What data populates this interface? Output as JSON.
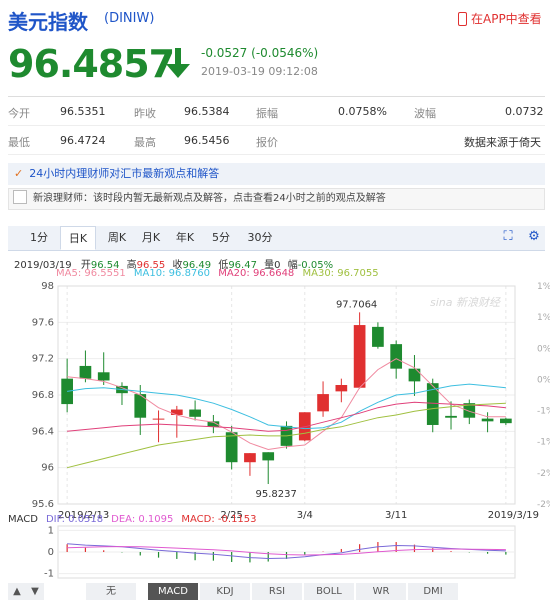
{
  "header": {
    "title": "美元指数",
    "code": "(DINIW)",
    "app_link": "在APP中查看"
  },
  "quote": {
    "price": "96.4857",
    "change": "-0.0527 (-0.0546%)",
    "timestamp": "2019-03-19 09:12:08",
    "direction": "down",
    "color_down": "#1e8a2f",
    "color_up": "#e03030"
  },
  "stats": {
    "row1": [
      {
        "label": "今开",
        "value": "96.5351"
      },
      {
        "label": "昨收",
        "value": "96.5384"
      },
      {
        "label": "振幅",
        "value": "0.0758%"
      },
      {
        "label": "波幅",
        "value": "0.0732"
      }
    ],
    "row2": [
      {
        "label": "最低",
        "value": "96.4724"
      },
      {
        "label": "最高",
        "value": "96.5456"
      },
      {
        "label": "报价",
        "value": ""
      },
      {
        "label": "",
        "value": "数据来源于倚天"
      }
    ]
  },
  "banner": {
    "text": "24小时内理财师对汇市最新观点和解答"
  },
  "notice": {
    "text": "新浪理财师：该时段内暂无最新观点及解答，点击查看24小时之前的观点及解答"
  },
  "tabs": [
    "1分",
    "日K",
    "周K",
    "月K",
    "年K",
    "5分",
    "30分"
  ],
  "active_tab": "日K",
  "ohlc_line": {
    "date": "2019/03/19",
    "open_label": "开",
    "open": "96.54",
    "high_label": "高",
    "high": "96.55",
    "close_label": "收",
    "close": "96.49",
    "low_label": "低",
    "low": "96.47",
    "vol_label": "量",
    "vol": "0",
    "amp_label": "幅",
    "amp": "-0.05%"
  },
  "ma_line": {
    "ma5": "MA5: 96.5551",
    "ma10": "MA10: 96.8760",
    "ma20": "MA20: 96.6648",
    "ma30": "MA30: 96.7055"
  },
  "watermark": "sina 新浪财经",
  "indicators": [
    "无",
    "MACD",
    "KDJ",
    "RSI",
    "BOLL",
    "WR",
    "DMI"
  ],
  "active_indicator": "MACD",
  "macd_line": {
    "label": "MACD",
    "dif": "DIF: 0.0518",
    "dea": "DEA: 0.1095",
    "macd": "MACD: -0.1153"
  },
  "colors": {
    "up": "#e03030",
    "down": "#1e8a2f",
    "ma5": "#f08aa0",
    "ma10": "#3dbfe0",
    "ma20": "#e0407a",
    "ma30": "#a0c040",
    "accent": "#1f55c8"
  },
  "chart_data": {
    "type": "candlestick",
    "y_ticks": [
      "98",
      "97.6",
      "97.2",
      "96.8",
      "96.4",
      "96",
      "95.6"
    ],
    "ylim": [
      95.6,
      98.0
    ],
    "pct_ticks": [
      "1%",
      "1%",
      "0%",
      "0%",
      "-1%",
      "-1%",
      "-2%",
      "-2%"
    ],
    "x_ticks": [
      "2019/2/13",
      "2/25",
      "3/4",
      "3/11",
      "2019/3/19"
    ],
    "high_label": "97.7064",
    "low_label": "95.8237",
    "candles": [
      {
        "o": 96.98,
        "h": 97.2,
        "l": 96.61,
        "c": 96.7
      },
      {
        "o": 97.12,
        "h": 97.29,
        "l": 96.94,
        "c": 96.98
      },
      {
        "o": 97.05,
        "h": 97.27,
        "l": 96.91,
        "c": 96.96
      },
      {
        "o": 96.9,
        "h": 96.94,
        "l": 96.69,
        "c": 96.82
      },
      {
        "o": 96.81,
        "h": 96.91,
        "l": 96.36,
        "c": 96.55
      },
      {
        "o": 96.53,
        "h": 96.63,
        "l": 96.28,
        "c": 96.54
      },
      {
        "o": 96.58,
        "h": 96.68,
        "l": 96.33,
        "c": 96.64
      },
      {
        "o": 96.64,
        "h": 96.74,
        "l": 96.52,
        "c": 96.56
      },
      {
        "o": 96.51,
        "h": 96.58,
        "l": 96.38,
        "c": 96.45
      },
      {
        "o": 96.39,
        "h": 96.46,
        "l": 95.98,
        "c": 96.06
      },
      {
        "o": 96.06,
        "h": 96.16,
        "l": 95.91,
        "c": 96.16
      },
      {
        "o": 96.17,
        "h": 96.17,
        "l": 95.82,
        "c": 96.08
      },
      {
        "o": 96.46,
        "h": 96.51,
        "l": 96.21,
        "c": 96.24
      },
      {
        "o": 96.3,
        "h": 96.61,
        "l": 96.29,
        "c": 96.61
      },
      {
        "o": 96.62,
        "h": 96.95,
        "l": 96.56,
        "c": 96.81
      },
      {
        "o": 96.84,
        "h": 96.98,
        "l": 96.72,
        "c": 96.91
      },
      {
        "o": 96.88,
        "h": 97.71,
        "l": 96.87,
        "c": 97.57
      },
      {
        "o": 97.55,
        "h": 97.6,
        "l": 97.31,
        "c": 97.33
      },
      {
        "o": 97.36,
        "h": 97.4,
        "l": 96.98,
        "c": 97.09
      },
      {
        "o": 97.09,
        "h": 97.24,
        "l": 96.79,
        "c": 96.95
      },
      {
        "o": 96.93,
        "h": 96.98,
        "l": 96.39,
        "c": 96.47
      },
      {
        "o": 96.57,
        "h": 96.73,
        "l": 96.42,
        "c": 96.55
      },
      {
        "o": 96.71,
        "h": 96.75,
        "l": 96.48,
        "c": 96.55
      },
      {
        "o": 96.54,
        "h": 96.61,
        "l": 96.39,
        "c": 96.51
      },
      {
        "o": 96.54,
        "h": 96.55,
        "l": 96.47,
        "c": 96.49
      }
    ],
    "ma5": [
      97.0,
      96.98,
      96.95,
      96.88,
      96.8,
      96.66,
      96.58,
      96.53,
      96.5,
      96.39,
      96.27,
      96.2,
      96.23,
      96.25,
      96.4,
      96.55,
      96.88,
      97.08,
      97.2,
      97.1,
      96.9,
      96.7,
      96.62,
      96.56,
      96.56
    ],
    "ma10": [
      96.84,
      96.87,
      96.88,
      96.86,
      96.84,
      96.82,
      96.8,
      96.76,
      96.71,
      96.64,
      96.56,
      96.47,
      96.45,
      96.43,
      96.44,
      96.5,
      96.62,
      96.72,
      96.8,
      96.82,
      96.86,
      96.9,
      96.92,
      96.9,
      96.88
    ],
    "ma20": [
      96.4,
      96.42,
      96.44,
      96.46,
      96.47,
      96.48,
      96.47,
      96.46,
      96.45,
      96.44,
      96.42,
      96.4,
      96.41,
      96.45,
      96.5,
      96.55,
      96.6,
      96.66,
      96.7,
      96.72,
      96.71,
      96.7,
      96.69,
      96.68,
      96.66
    ],
    "ma30": [
      96.0,
      96.05,
      96.1,
      96.15,
      96.2,
      96.25,
      96.28,
      96.31,
      96.34,
      96.35,
      96.36,
      96.35,
      96.35,
      96.38,
      96.42,
      96.45,
      96.5,
      96.55,
      96.58,
      96.62,
      96.65,
      96.67,
      96.69,
      96.7,
      96.71
    ],
    "macd": {
      "y_ticks": [
        "1",
        "0",
        "-1"
      ],
      "ylim": [
        -1.2,
        1.2
      ],
      "dif": [
        0.38,
        0.32,
        0.28,
        0.24,
        0.16,
        0.08,
        0.02,
        -0.05,
        -0.1,
        -0.18,
        -0.26,
        -0.3,
        -0.28,
        -0.22,
        -0.12,
        -0.04,
        0.12,
        0.24,
        0.3,
        0.28,
        0.22,
        0.16,
        0.12,
        0.08,
        0.05
      ],
      "dea": [
        0.2,
        0.22,
        0.24,
        0.25,
        0.24,
        0.21,
        0.18,
        0.14,
        0.1,
        0.05,
        -0.02,
        -0.08,
        -0.12,
        -0.14,
        -0.13,
        -0.11,
        -0.06,
        0.01,
        0.07,
        0.11,
        0.13,
        0.14,
        0.13,
        0.12,
        0.11
      ],
      "hist": [
        0.36,
        0.2,
        0.08,
        -0.02,
        -0.16,
        -0.26,
        -0.32,
        -0.38,
        -0.4,
        -0.46,
        -0.48,
        -0.44,
        -0.32,
        -0.16,
        0.02,
        0.14,
        0.36,
        0.46,
        0.46,
        0.34,
        0.18,
        0.04,
        -0.02,
        -0.08,
        -0.12
      ]
    }
  }
}
